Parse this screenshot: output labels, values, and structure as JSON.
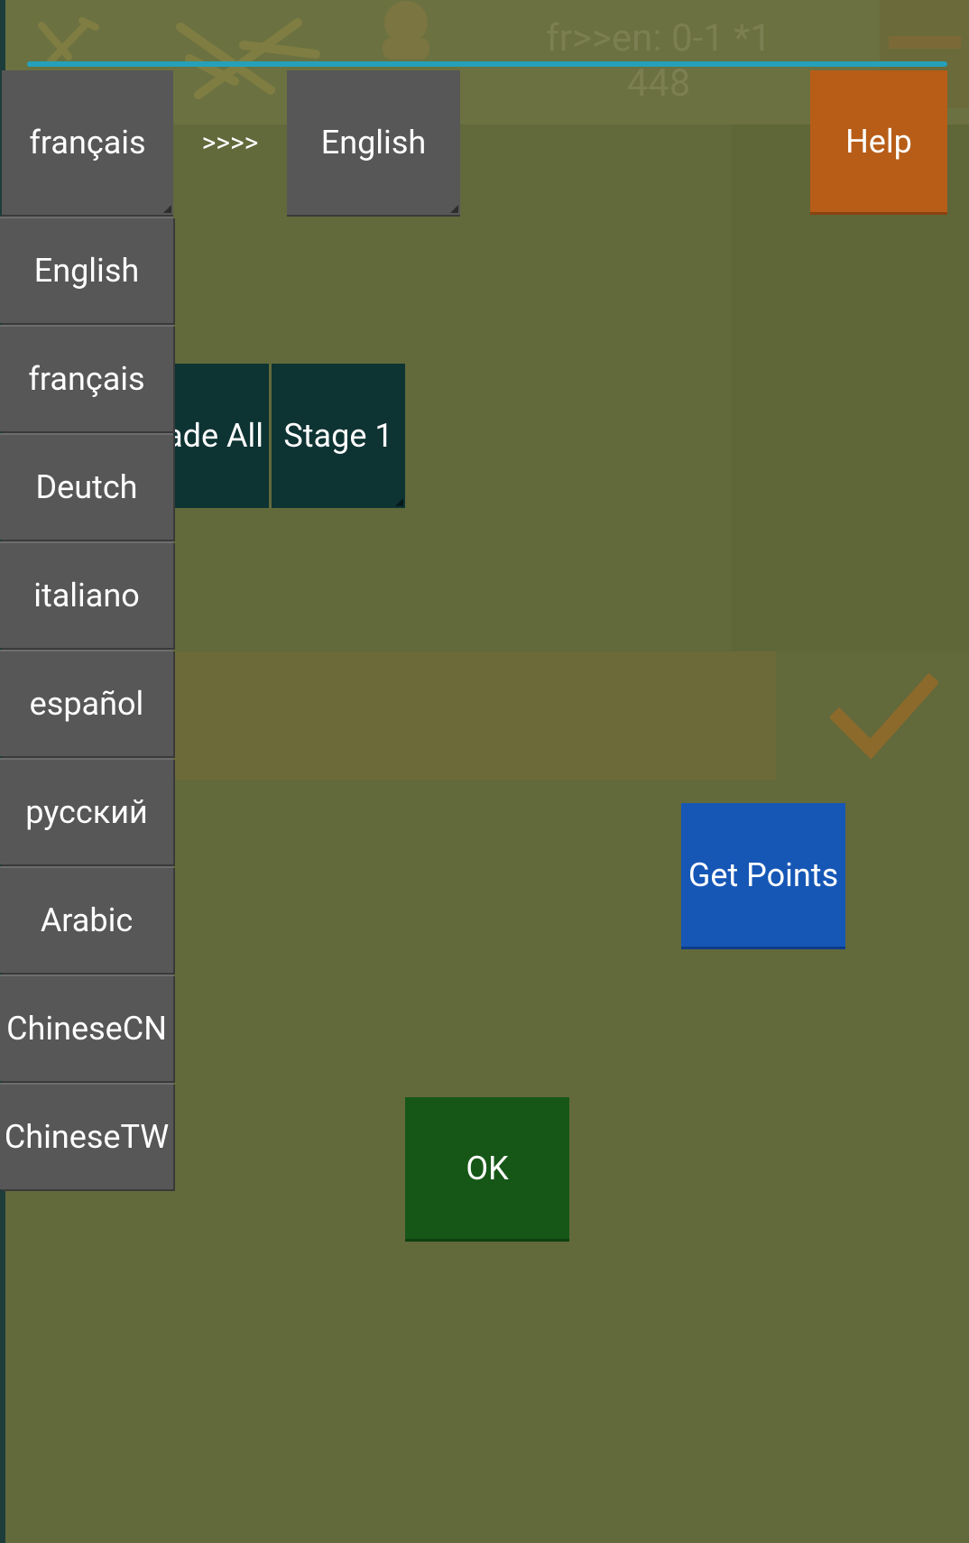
{
  "app": {
    "score_line1": "fr>>en: 0-1 *1",
    "score_line2": "448",
    "progress_fraction": 1.0
  },
  "toolbar": {
    "source_language": "français",
    "direction": ">>>>",
    "target_language": "English",
    "help_label": "Help"
  },
  "stage": {
    "grade_label": "Grade All",
    "stage_label": "Stage 1"
  },
  "dropdown": {
    "items": [
      "English",
      "français",
      "Deutch",
      "italiano",
      "español",
      "русский",
      "Arabic",
      "ChineseCN",
      "ChineseTW"
    ]
  },
  "actions": {
    "get_points_label": "Get Points",
    "ok_label": "OK"
  },
  "colors": {
    "background": "#62693b",
    "language_button": "#575757",
    "help_button": "#b75d18",
    "stage_button": "#0e3333",
    "get_points_button": "#1657b6",
    "ok_button": "#165718",
    "progress": "#26a0b8"
  },
  "icons": {
    "tools": "tools-icon",
    "crossed_tools": "crossed-tools-icon",
    "profile": "profile-icon",
    "checkmark": "checkmark-icon"
  }
}
